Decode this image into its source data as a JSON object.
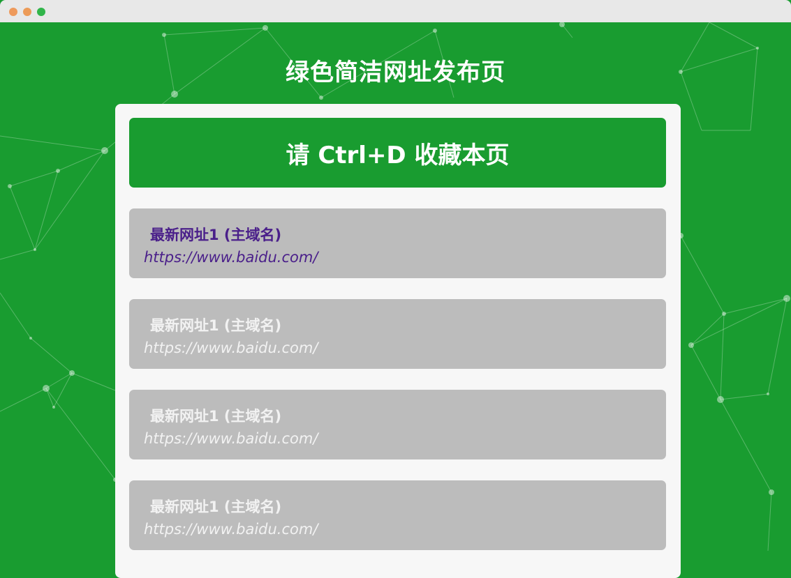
{
  "window": {
    "controls": [
      "close",
      "minimize",
      "maximize"
    ]
  },
  "page": {
    "title": "绿色简洁网址发布页",
    "banner": "请 Ctrl+D 收藏本页"
  },
  "links": [
    {
      "name": "最新网址1 (主域名)",
      "url": "https://www.baidu.com/",
      "visited": true
    },
    {
      "name": "最新网址1 (主域名)",
      "url": "https://www.baidu.com/",
      "visited": false
    },
    {
      "name": "最新网址1 (主域名)",
      "url": "https://www.baidu.com/",
      "visited": false
    },
    {
      "name": "最新网址1 (主域名)",
      "url": "https://www.baidu.com/",
      "visited": false
    }
  ],
  "colors": {
    "background": "#199c30",
    "panel": "#f7f7f7",
    "card": "#bcbcbc",
    "visited_text": "#4a1f8a",
    "card_text": "#f2f2f2"
  }
}
